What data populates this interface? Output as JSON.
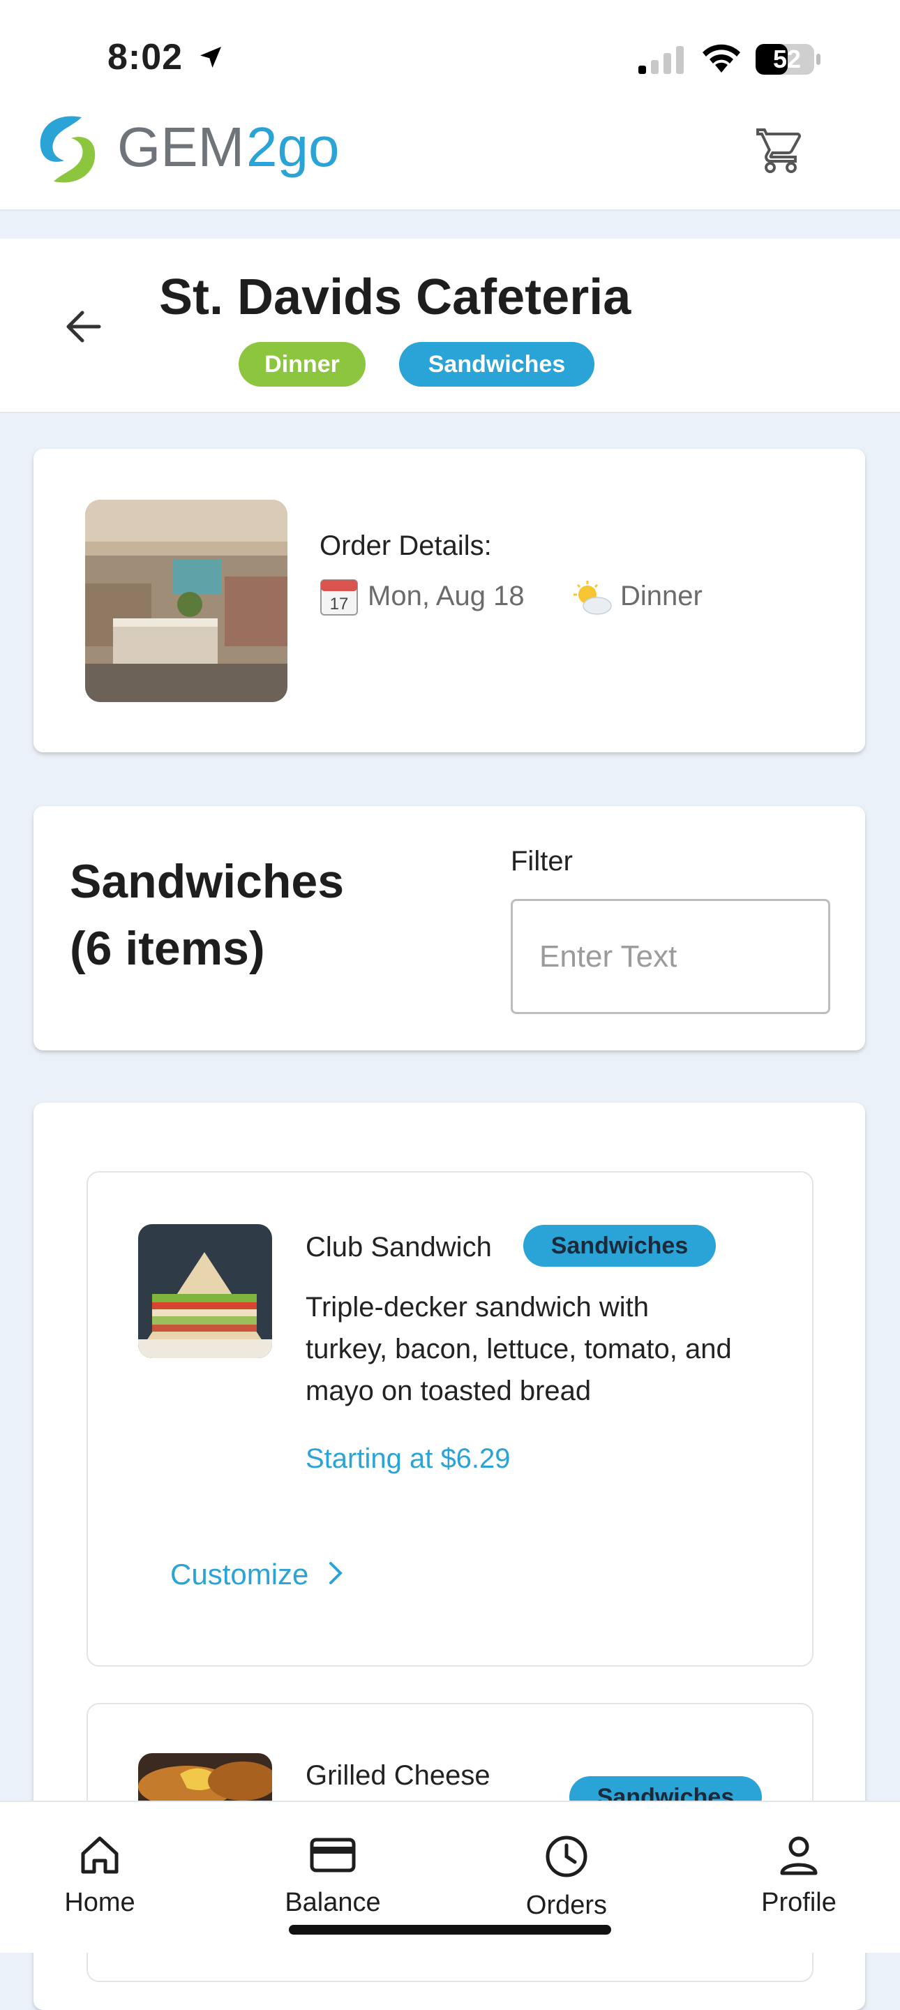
{
  "status_bar": {
    "time": "8:02",
    "battery": "52"
  },
  "app": {
    "brand_part1": "GEM",
    "brand_part2": "2go"
  },
  "header": {
    "title": "St. Davids Cafeteria",
    "tags": [
      "Dinner",
      "Sandwiches"
    ]
  },
  "order": {
    "label": "Order Details:",
    "date": "Mon, Aug 18",
    "meal": "Dinner",
    "calendar_day": "17"
  },
  "section": {
    "title_line1": "Sandwiches",
    "title_line2": "(6 items)",
    "filter_label": "Filter",
    "filter_placeholder": "Enter Text"
  },
  "items": [
    {
      "name": "Club Sandwich",
      "badge": "Sandwiches",
      "description": "Triple-decker sandwich with turkey, bacon, lettuce, tomato, and mayo on toasted bread",
      "price": "Starting at $6.29",
      "action": "Customize"
    },
    {
      "name": "Grilled Cheese",
      "badge": "Sandwiches"
    }
  ],
  "nav": [
    {
      "label": "Home",
      "icon": "home-icon"
    },
    {
      "label": "Balance",
      "icon": "card-icon"
    },
    {
      "label": "Orders",
      "icon": "clock-icon"
    },
    {
      "label": "Profile",
      "icon": "person-icon"
    }
  ],
  "colors": {
    "brand_blue": "#2aa3d6",
    "dinner_green": "#8cc63f",
    "background": "#eaf1f8"
  }
}
